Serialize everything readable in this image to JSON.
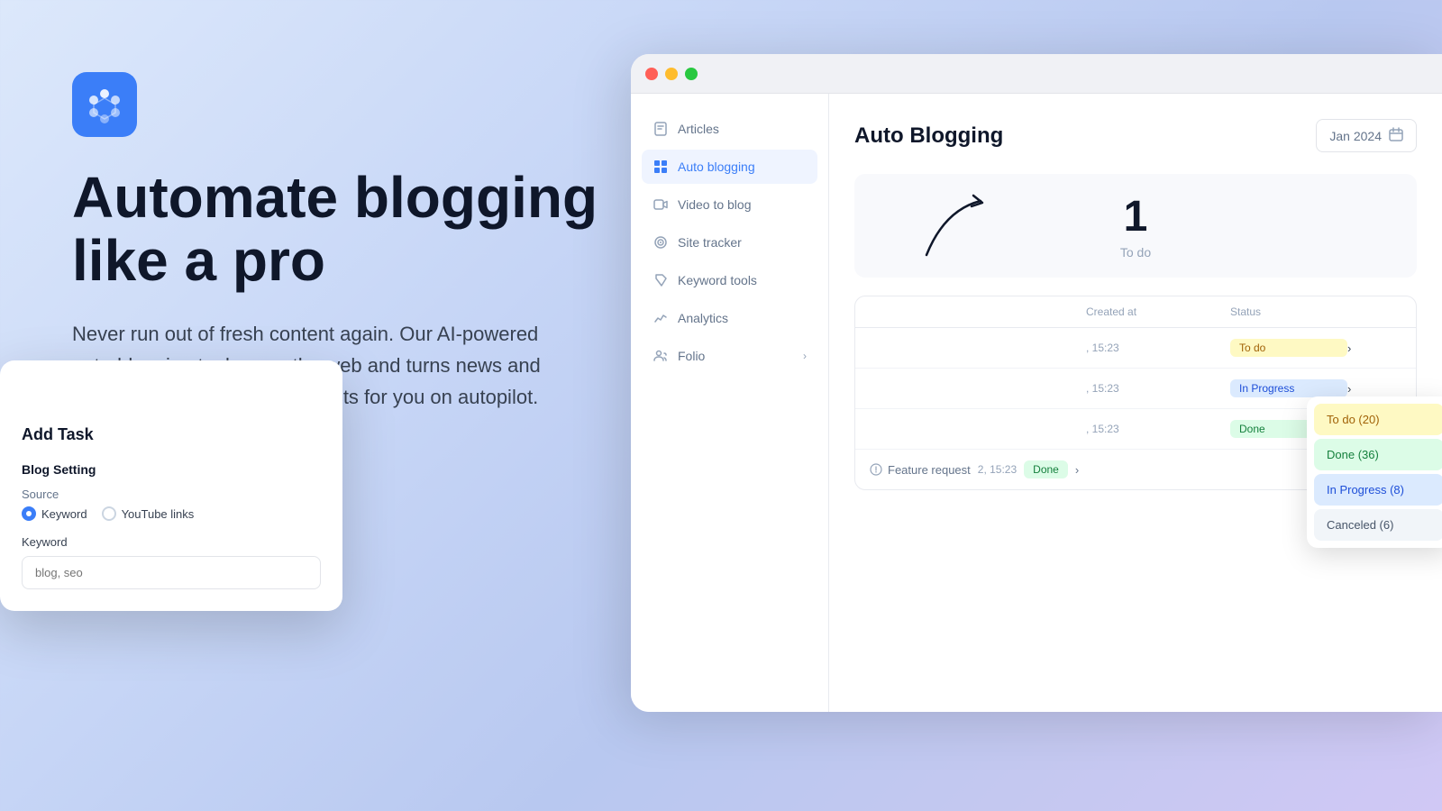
{
  "brand": {
    "logo_alt": "App Logo"
  },
  "hero": {
    "headline_line1": "Automate blogging",
    "headline_line2": "like a pro",
    "subtext": "Never run out of fresh content again. Our AI-powered auto-blogging tool scans the web and turns news and articles into optimized blog posts for you on autopilot."
  },
  "window": {
    "titlebar": {
      "dot_red": "close",
      "dot_yellow": "minimize",
      "dot_green": "maximize"
    }
  },
  "sidebar": {
    "items": [
      {
        "id": "articles",
        "label": "Articles",
        "icon": "bookmark-icon"
      },
      {
        "id": "auto-blogging",
        "label": "Auto blogging",
        "icon": "grid-icon",
        "active": true
      },
      {
        "id": "video-to-blog",
        "label": "Video to blog",
        "icon": "video-icon"
      },
      {
        "id": "site-tracker",
        "label": "Site tracker",
        "icon": "target-icon"
      },
      {
        "id": "keyword-tools",
        "label": "Keyword tools",
        "icon": "bookmark-tag-icon"
      },
      {
        "id": "analytics",
        "label": "Analytics",
        "icon": "chart-icon"
      },
      {
        "id": "folio",
        "label": "Folio",
        "icon": "users-icon",
        "has_arrow": true
      }
    ]
  },
  "main": {
    "title": "Auto Blogging",
    "date_picker_value": "Jan 2024",
    "stats": {
      "number": "1",
      "label": "To do"
    },
    "table": {
      "columns": [
        "",
        "Created at",
        "Status",
        ""
      ],
      "rows": [
        {
          "name": "",
          "created_at": ", 15:23",
          "status": "To do"
        },
        {
          "name": "",
          "created_at": ", 15:23",
          "status": "In Progress"
        },
        {
          "name": "",
          "created_at": ", 15:23",
          "status": "Done"
        },
        {
          "name": "Feature request",
          "created_at": "2, 15:23",
          "status": "Done"
        }
      ]
    }
  },
  "add_task_modal": {
    "title": "Add Task",
    "section_title": "Blog Setting",
    "source_label": "Source",
    "source_options": [
      {
        "id": "keyword",
        "label": "Keyword",
        "checked": true
      },
      {
        "id": "youtube",
        "label": "YouTube links",
        "checked": false
      }
    ],
    "keyword_label": "Keyword",
    "keyword_placeholder": "blog, seo"
  },
  "stats_popup": {
    "items": [
      {
        "label": "To do (20)",
        "type": "todo"
      },
      {
        "label": "Done (36)",
        "type": "done"
      },
      {
        "label": "In Progress (8)",
        "type": "inprogress"
      },
      {
        "label": "Canceled (6)",
        "type": "cancelled"
      }
    ]
  }
}
